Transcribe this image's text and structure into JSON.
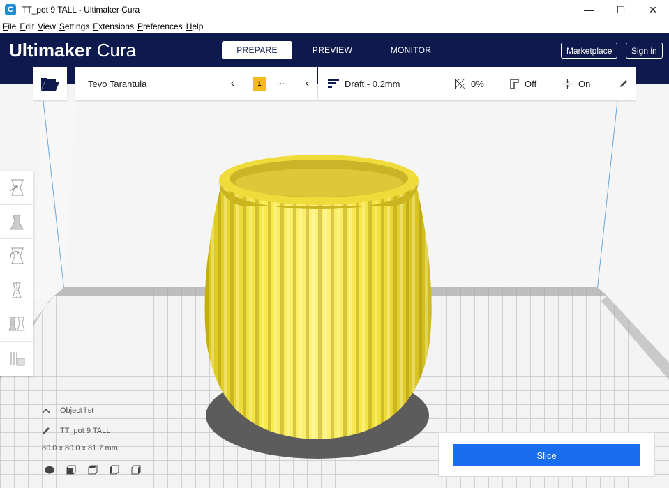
{
  "window": {
    "title": "TT_pot 9 TALL - Ultimaker Cura",
    "app_icon_letter": "C",
    "controls": [
      "—",
      "☐",
      "✕"
    ]
  },
  "menu": [
    "File",
    "Edit",
    "View",
    "Settings",
    "Extensions",
    "Preferences",
    "Help"
  ],
  "header": {
    "logo_bold": "Ultimaker",
    "logo_light": "Cura",
    "tabs": [
      {
        "label": "PREPARE",
        "active": true
      },
      {
        "label": "PREVIEW",
        "active": false
      },
      {
        "label": "MONITOR",
        "active": false
      }
    ],
    "marketplace_label": "Marketplace",
    "signin_label": "Sign in"
  },
  "printer": {
    "name": "Tevo Tarantula",
    "extruder_number": "1",
    "extruder_material": "···"
  },
  "print_settings": {
    "profile": "Draft - 0.2mm",
    "infill": "0%",
    "support": "Off",
    "adhesion": "On"
  },
  "object_list": {
    "header": "Object list",
    "object_name": "TT_pot 9 TALL",
    "dimensions": "80.0 x 80.0 x 81.7 mm"
  },
  "slice": {
    "button_label": "Slice"
  },
  "colors": {
    "header_bg": "#0e1a4e",
    "accent_blue": "#196ef0",
    "model_yellow": "#f5e03a",
    "badge_yellow": "#f3ba1a"
  }
}
